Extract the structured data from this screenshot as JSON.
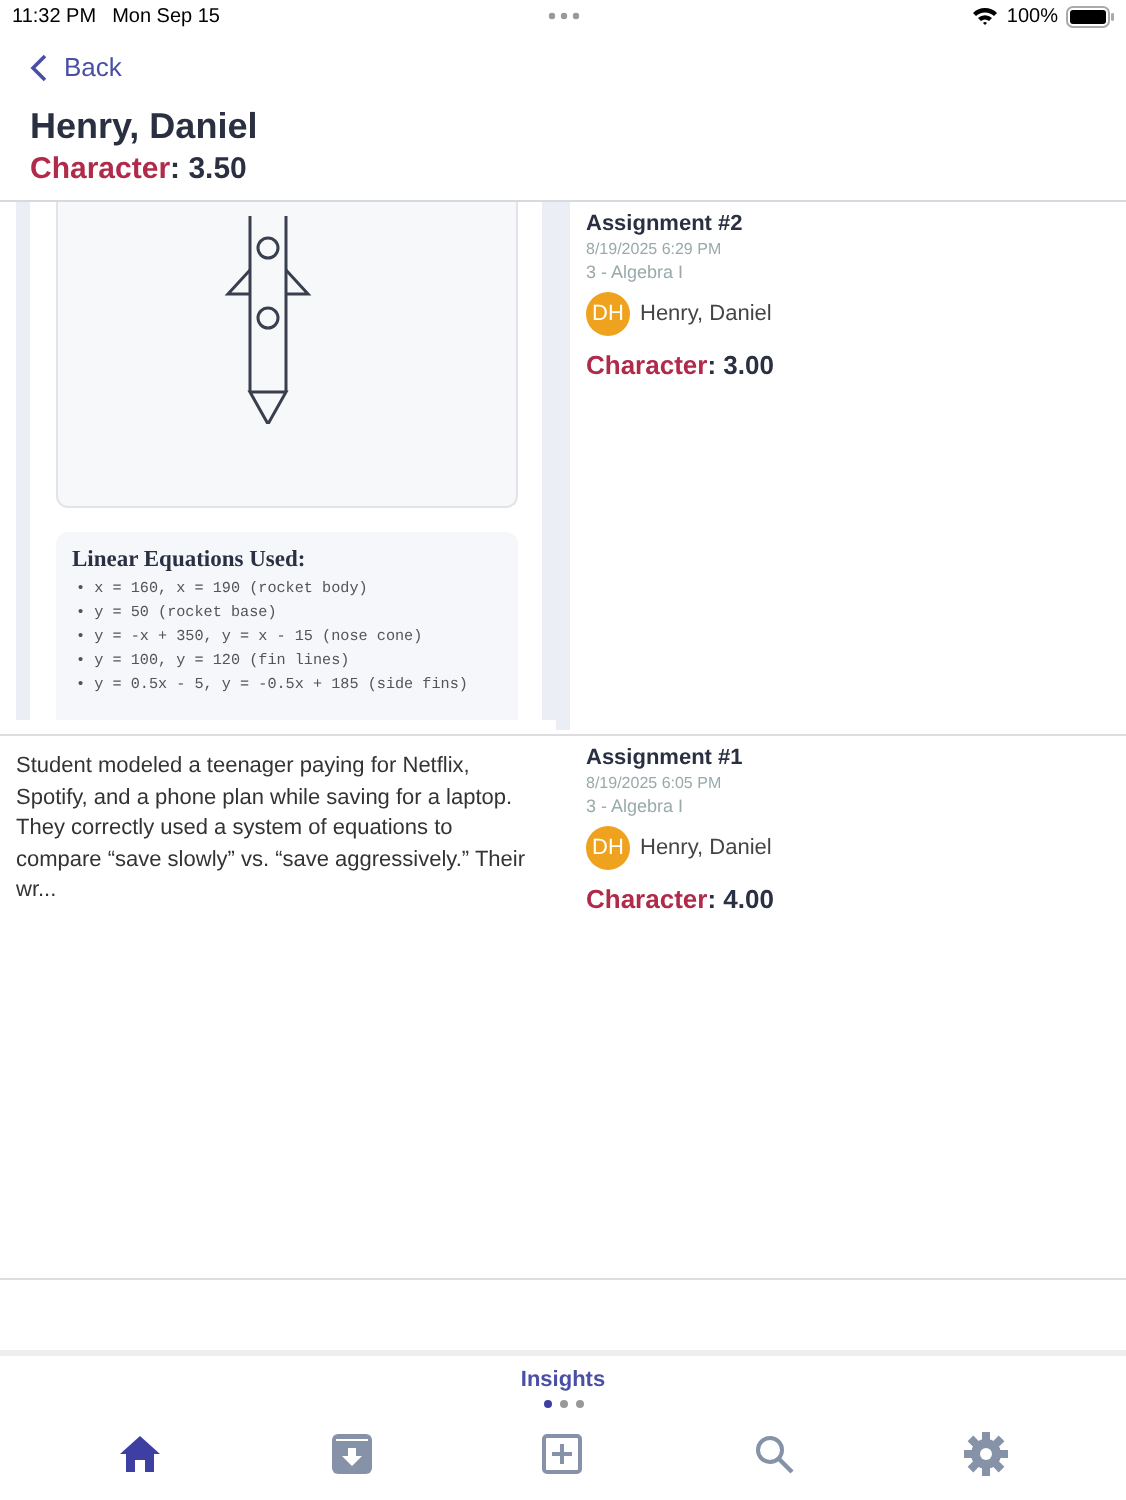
{
  "status_bar": {
    "time": "11:32 PM",
    "date": "Mon Sep 15",
    "battery": "100%"
  },
  "nav": {
    "back": "Back"
  },
  "header": {
    "name": "Henry, Daniel",
    "score": "Character: 3.50"
  },
  "entries": [
    {
      "kind": "drawing",
      "equations_title": "Linear Equations Used:",
      "equations": [
        "• x = 160, x = 190 (rocket body)",
        "• y = 50 (rocket base)",
        "• y = -x + 350, y = x - 15 (nose cone)",
        "• y = 100, y = 120 (fin lines)",
        "• y = 0.5x - 5, y = -0.5x + 185 (side fins)"
      ],
      "title": "Assignment #2",
      "date": "8/19/2025 6:29 PM",
      "class": "3 - Algebra I",
      "initials": "DH",
      "student": "Henry, Daniel",
      "score": "Character: 3.00"
    },
    {
      "kind": "text",
      "summary": "Student modeled a teenager paying for Netflix, Spotify, and a phone plan while saving for a laptop. They correctly used a system of equations to compare “save slowly” vs. “save aggressively.” Their wr...",
      "title": "Assignment #1",
      "date": "8/19/2025 6:05 PM",
      "class": "3 - Algebra I",
      "initials": "DH",
      "student": "Henry, Daniel",
      "score": "Character: 4.00"
    }
  ],
  "pager": {
    "title": "Insights",
    "dots": [
      {
        "selected": true
      },
      {
        "selected": false
      },
      {
        "selected": false
      }
    ]
  },
  "tabs": [
    {
      "kind": "home",
      "selected": true
    },
    {
      "kind": "archive",
      "selected": false
    },
    {
      "kind": "add",
      "selected": false
    },
    {
      "kind": "search",
      "selected": false
    },
    {
      "kind": "settings",
      "selected": false
    }
  ]
}
